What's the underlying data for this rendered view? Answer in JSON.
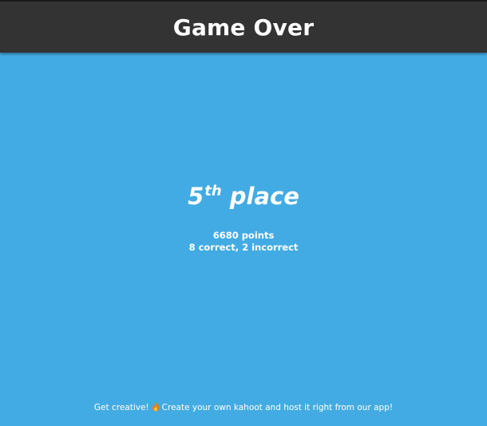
{
  "header": {
    "title": "Game Over"
  },
  "result": {
    "place_number": "5",
    "place_suffix": "th",
    "place_word": "place",
    "points": "6680 points",
    "answers": "8 correct, 2 incorrect"
  },
  "footer": {
    "lead": "Get creative!",
    "icon": "flame-icon",
    "message": "Create your own kahoot and host it right from our app!"
  },
  "colors": {
    "background": "#43abe3",
    "header": "#333333",
    "text": "#ffffff"
  }
}
